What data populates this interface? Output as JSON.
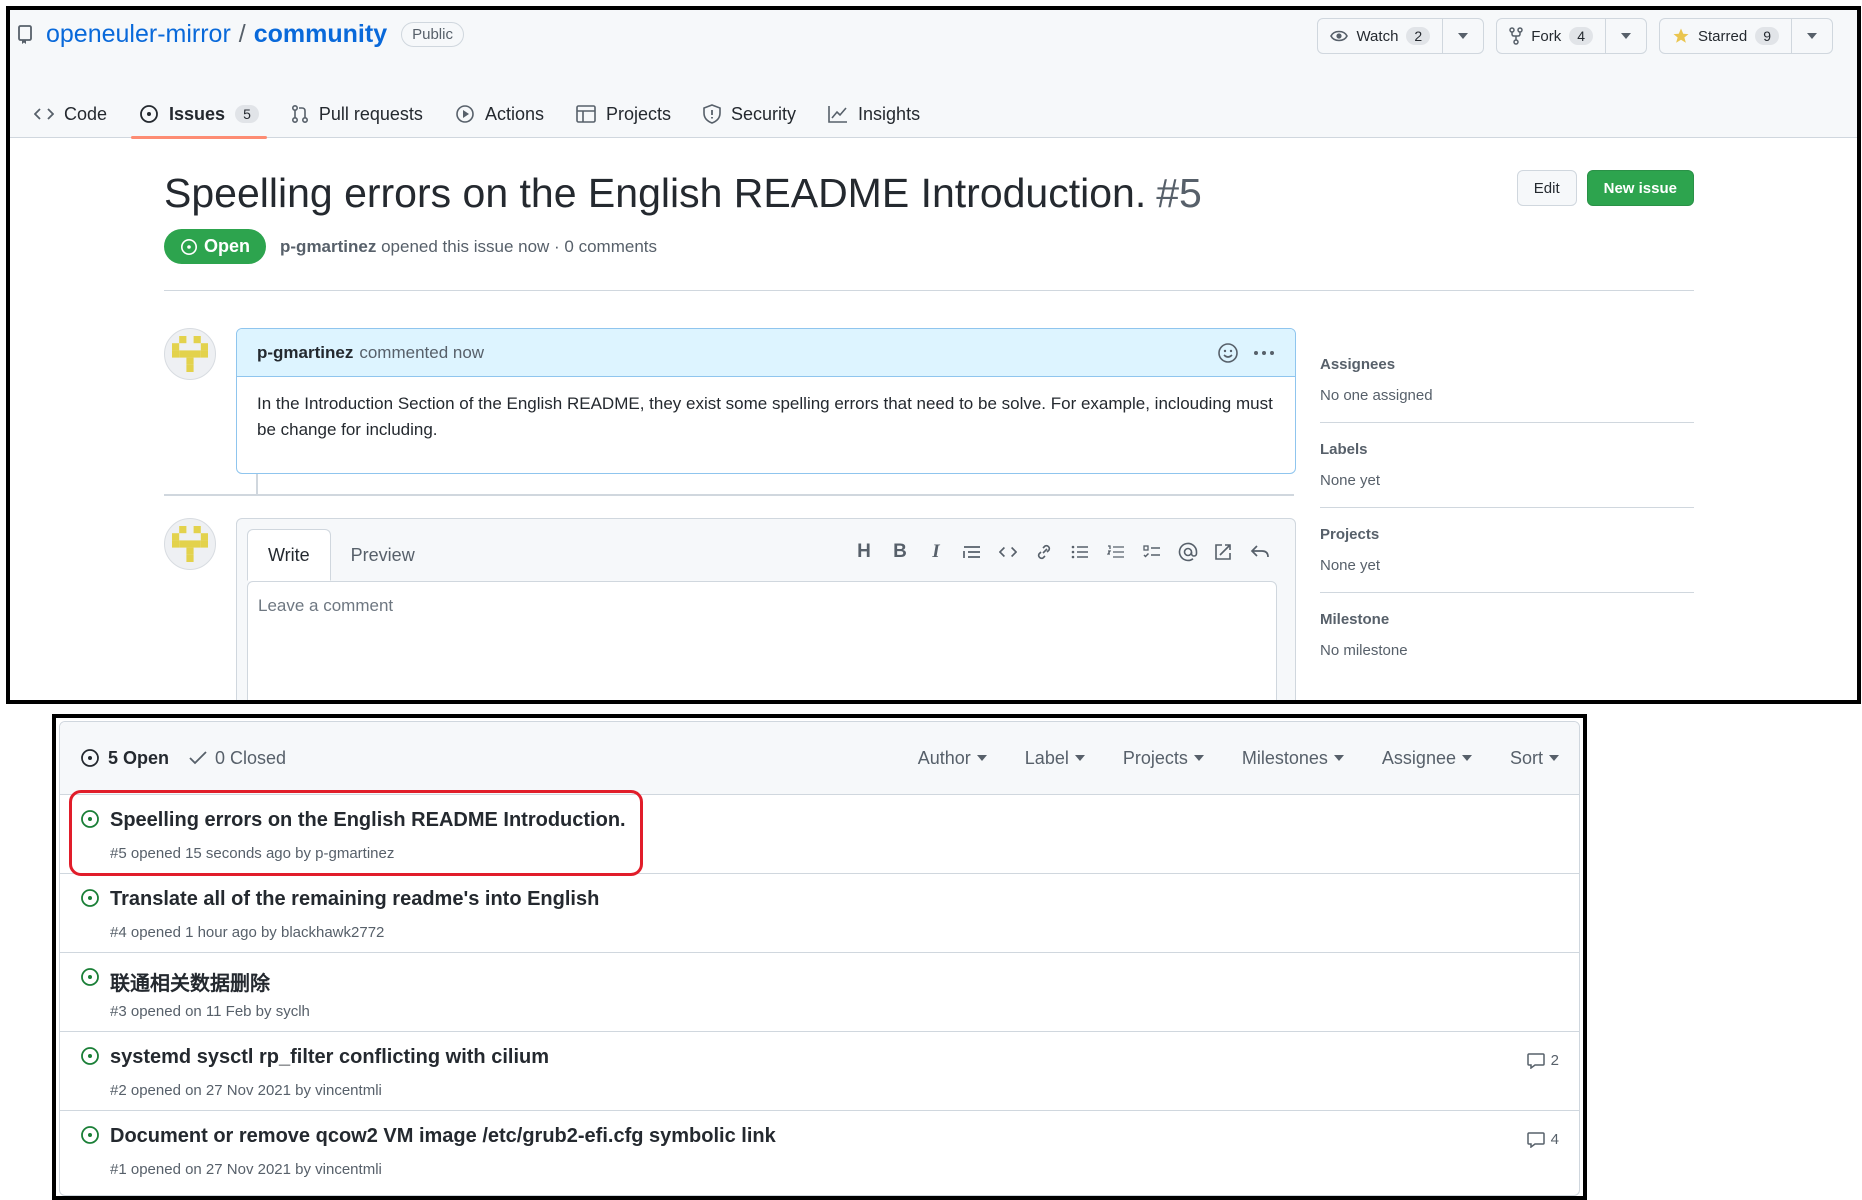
{
  "repo": {
    "owner": "openeuler-mirror",
    "separator": "/",
    "name": "community",
    "visibility": "Public",
    "actions": [
      {
        "label": "Watch",
        "count": "2",
        "icon": "eye-icon"
      },
      {
        "label": "Fork",
        "count": "4",
        "icon": "fork-icon"
      },
      {
        "label": "Starred",
        "count": "9",
        "icon": "star-filled-icon"
      }
    ]
  },
  "nav": [
    {
      "label": "Code",
      "icon": "code-icon"
    },
    {
      "label": "Issues",
      "count": "5",
      "icon": "issue-open-icon",
      "active": true
    },
    {
      "label": "Pull requests",
      "icon": "git-pull-request-icon"
    },
    {
      "label": "Actions",
      "icon": "play-icon"
    },
    {
      "label": "Projects",
      "icon": "table-icon"
    },
    {
      "label": "Security",
      "icon": "shield-icon"
    },
    {
      "label": "Insights",
      "icon": "graph-icon"
    }
  ],
  "issue": {
    "title": "Speelling errors on the English README Introduction.",
    "number": "#5",
    "state": "Open",
    "author": "p-gmartinez",
    "meta_text": "opened this issue now · 0 comments",
    "edit_label": "Edit",
    "new_issue_label": "New issue"
  },
  "comment": {
    "author": "p-gmartinez",
    "when": "commented now",
    "body": "In the Introduction Section of the English README, they exist some spelling errors that need to be solve. For example, inclouding must be change for including."
  },
  "composer": {
    "write_tab": "Write",
    "preview_tab": "Preview",
    "placeholder": "Leave a comment"
  },
  "sidebar": [
    {
      "title": "Assignees",
      "value": "No one assigned"
    },
    {
      "title": "Labels",
      "value": "None yet"
    },
    {
      "title": "Projects",
      "value": "None yet"
    },
    {
      "title": "Milestone",
      "value": "No milestone"
    }
  ],
  "issue_list": {
    "open_label": "5 Open",
    "closed_label": "0 Closed",
    "filters": [
      "Author",
      "Label",
      "Projects",
      "Milestones",
      "Assignee",
      "Sort"
    ],
    "rows": [
      {
        "title": "Speelling errors on the English README Introduction.",
        "meta": "#5 opened 15 seconds ago by p-gmartinez",
        "comments": ""
      },
      {
        "title": "Translate all of the remaining readme's into English",
        "meta": "#4 opened 1 hour ago by blackhawk2772",
        "comments": ""
      },
      {
        "title": "联通相关数据删除",
        "meta": "#3 opened on 11 Feb by syclh",
        "comments": ""
      },
      {
        "title": "systemd sysctl rp_filter conflicting with cilium",
        "meta": "#2 opened on 27 Nov 2021 by vincentmli",
        "comments": "2"
      },
      {
        "title": "Document or remove qcow2 VM image /etc/grub2-efi.cfg symbolic link",
        "meta": "#1 opened on 27 Nov 2021 by vincentmli",
        "comments": "4"
      }
    ]
  },
  "colors": {
    "accent_link": "#0969da",
    "open_green": "#2da44e",
    "highlight_red": "#e11d2a",
    "active_tab_underline": "#fd8c73"
  }
}
